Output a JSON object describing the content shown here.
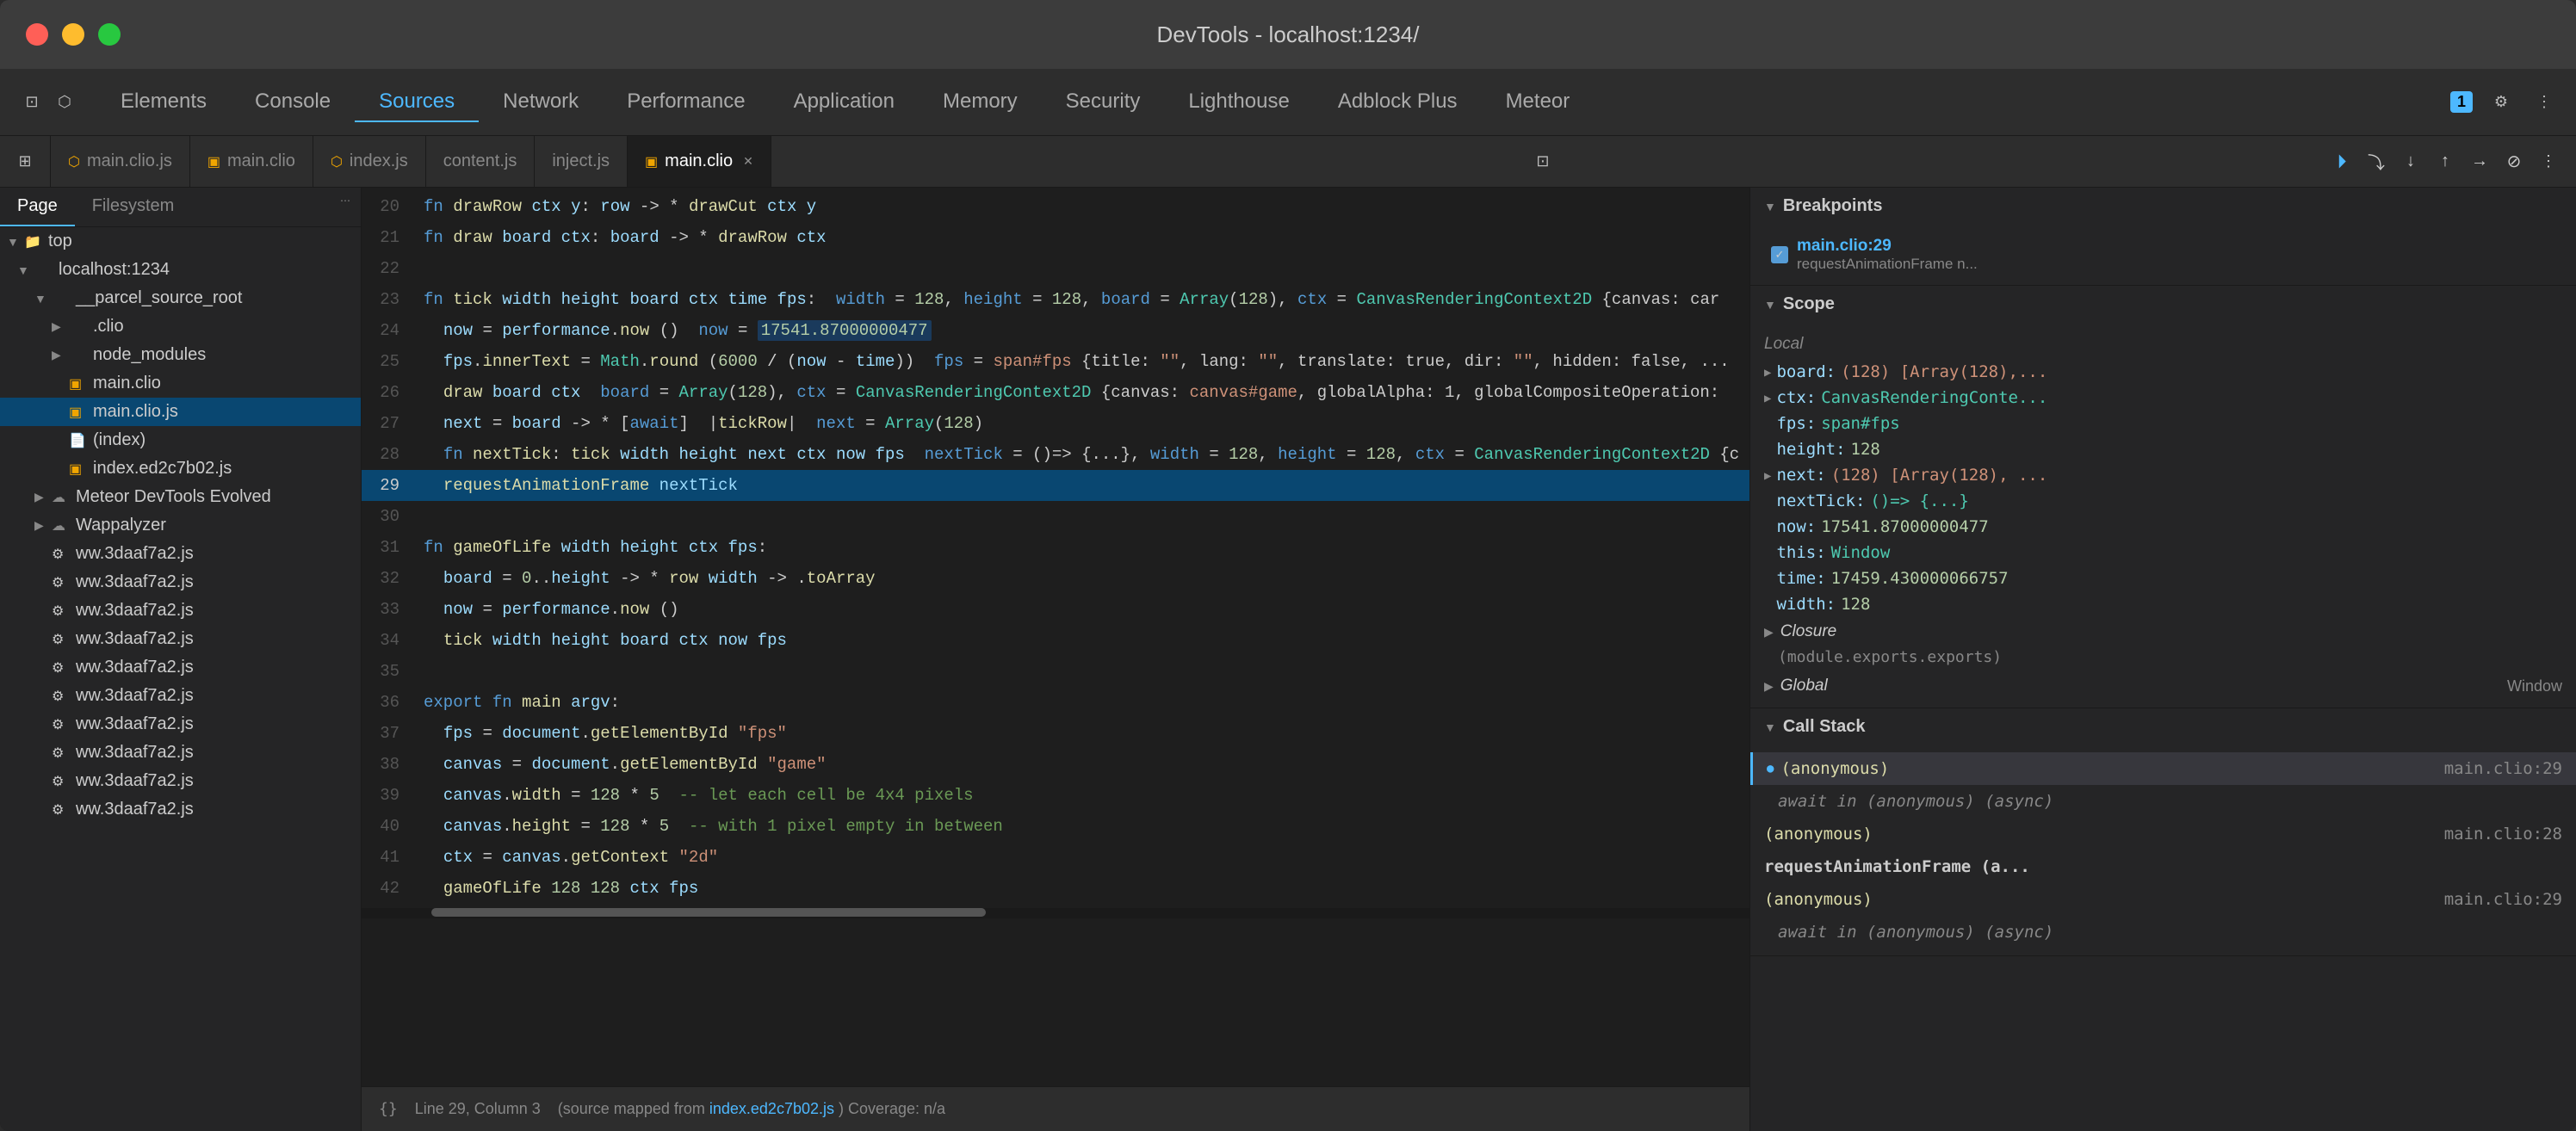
{
  "window": {
    "title": "DevTools - localhost:1234/"
  },
  "toolbar": {
    "nav_items": [
      {
        "label": "Elements",
        "active": false
      },
      {
        "label": "Console",
        "active": false
      },
      {
        "label": "Sources",
        "active": true
      },
      {
        "label": "Network",
        "active": false
      },
      {
        "label": "Performance",
        "active": false
      },
      {
        "label": "Application",
        "active": false
      },
      {
        "label": "Memory",
        "active": false
      },
      {
        "label": "Security",
        "active": false
      },
      {
        "label": "Lighthouse",
        "active": false
      },
      {
        "label": "Adblock Plus",
        "active": false
      },
      {
        "label": "Meteor",
        "active": false
      }
    ],
    "badge": "1"
  },
  "tabs": [
    {
      "label": "main.clio.js",
      "icon": "js",
      "active": false,
      "closeable": false
    },
    {
      "label": "main.clio",
      "icon": "clio",
      "active": false,
      "closeable": false
    },
    {
      "label": "index.js",
      "icon": "js",
      "active": false,
      "closeable": false
    },
    {
      "label": "content.js",
      "icon": "js",
      "active": false,
      "closeable": false
    },
    {
      "label": "inject.js",
      "icon": "js",
      "active": false,
      "closeable": false
    },
    {
      "label": "main.clio",
      "icon": "clio",
      "active": true,
      "closeable": true
    }
  ],
  "sidebar": {
    "tabs": [
      "Page",
      "Filesystem"
    ],
    "active_tab": "Page",
    "tree": [
      {
        "indent": 0,
        "type": "folder",
        "label": "top",
        "expanded": true
      },
      {
        "indent": 1,
        "type": "folder",
        "label": "localhost:1234",
        "expanded": true
      },
      {
        "indent": 2,
        "type": "folder",
        "label": "__parcel_source_root",
        "expanded": true
      },
      {
        "indent": 3,
        "type": "folder",
        "label": ".clio",
        "expanded": false
      },
      {
        "indent": 3,
        "type": "folder",
        "label": "node_modules",
        "expanded": false
      },
      {
        "indent": 3,
        "type": "file",
        "label": "main.clio",
        "selected": false
      },
      {
        "indent": 3,
        "type": "file-js",
        "label": "main.clio.js",
        "selected": false,
        "highlighted": true
      },
      {
        "indent": 3,
        "type": "file",
        "label": "(index)",
        "selected": false
      },
      {
        "indent": 3,
        "type": "file-js",
        "label": "index.ed2c7b02.js",
        "selected": false
      },
      {
        "indent": 2,
        "type": "folder-cloud",
        "label": "Meteor DevTools Evolved",
        "expanded": false
      },
      {
        "indent": 2,
        "type": "folder-cloud",
        "label": "Wappalyzer",
        "expanded": false
      },
      {
        "indent": 2,
        "type": "file-js",
        "label": "ww.3daaf7a2.js",
        "selected": false
      },
      {
        "indent": 2,
        "type": "file-js",
        "label": "ww.3daaf7a2.js",
        "selected": false
      },
      {
        "indent": 2,
        "type": "file-js",
        "label": "ww.3daaf7a2.js",
        "selected": false
      },
      {
        "indent": 2,
        "type": "file-js",
        "label": "ww.3daaf7a2.js",
        "selected": false
      },
      {
        "indent": 2,
        "type": "file-js",
        "label": "ww.3daaf7a2.js",
        "selected": false
      },
      {
        "indent": 2,
        "type": "file-js",
        "label": "ww.3daaf7a2.js",
        "selected": false
      },
      {
        "indent": 2,
        "type": "file-js",
        "label": "ww.3daaf7a2.js",
        "selected": false
      },
      {
        "indent": 2,
        "type": "file-js",
        "label": "ww.3daaf7a2.js",
        "selected": false
      },
      {
        "indent": 2,
        "type": "file-js",
        "label": "ww.3daaf7a2.js",
        "selected": false
      },
      {
        "indent": 2,
        "type": "file-js",
        "label": "ww.3daaf7a2.js",
        "selected": false
      }
    ]
  },
  "code": {
    "lines": [
      {
        "num": 20,
        "content": "fn drawRow ctx y: row -> * drawCut ctx y"
      },
      {
        "num": 21,
        "content": "fn draw board ctx: board -> * drawRow ctx"
      },
      {
        "num": 22,
        "content": ""
      },
      {
        "num": 23,
        "content": "fn tick width height board ctx time fps:  width = 128, height = 128, board = Array(128), ctx = CanvasRenderingContext2D {canvas: car"
      },
      {
        "num": 24,
        "content": "  now = performance.now ()  now = 17541.87000000477"
      },
      {
        "num": 25,
        "content": "  fps.innerText = Math.round (6000 / (now - time))  fps = span#fps {title: \"\", lang: \"\", translate: true, dir: \"\", hidden: false, ..."
      },
      {
        "num": 26,
        "content": "  draw board ctx  board = Array(128), ctx = CanvasRenderingContext2D {canvas: canvas#game, globalAlpha: 1, globalCompositeOperation:"
      },
      {
        "num": 27,
        "content": "  next = board -> * [await]  |tickRow|  next = Array(128)"
      },
      {
        "num": 28,
        "content": "  fn nextTick: tick width height next ctx now fps  nextTick = ()=> {...}, width = 128, height = 128, ctx = CanvasRenderingContext2D {c"
      },
      {
        "num": 29,
        "content": "  requestAnimationFrame nextTick",
        "current": true,
        "highlighted": true
      },
      {
        "num": 30,
        "content": ""
      },
      {
        "num": 31,
        "content": "fn gameOfLife width height ctx fps:"
      },
      {
        "num": 32,
        "content": "  board = 0..height -> * row width -> .toArray"
      },
      {
        "num": 33,
        "content": "  now = performance.now ()"
      },
      {
        "num": 34,
        "content": "  tick width height board ctx now fps"
      },
      {
        "num": 35,
        "content": ""
      },
      {
        "num": 36,
        "content": "export fn main argv:"
      },
      {
        "num": 37,
        "content": "  fps = document.getElementById \"fps\""
      },
      {
        "num": 38,
        "content": "  canvas = document.getElementById \"game\""
      },
      {
        "num": 39,
        "content": "  canvas.width = 128 * 5  -- let each cell be 4x4 pixels"
      },
      {
        "num": 40,
        "content": "  canvas.height = 128 * 5  -- with 1 pixel empty in between"
      },
      {
        "num": 41,
        "content": "  ctx = canvas.getContext \"2d\""
      },
      {
        "num": 42,
        "content": "  gameOfLife 128 128 ctx fps"
      }
    ]
  },
  "right_panel": {
    "breakpoints_header": "Breakpoints",
    "breakpoints": [
      {
        "file": "main.clio:29",
        "text": "requestAnimationFrame n..."
      }
    ],
    "scope_header": "Scope",
    "scope_local_header": "Local",
    "scope_items": [
      {
        "key": "board:",
        "val": "(128) [Array(128),...",
        "arrow": true
      },
      {
        "key": "ctx:",
        "val": "CanvasRenderin...",
        "arrow": false
      },
      {
        "key": "fps:",
        "val": "span#fps",
        "arrow": false
      },
      {
        "key": "height:",
        "val": "128",
        "arrow": false
      },
      {
        "key": "next:",
        "val": "(128) [Array(128), ...",
        "arrow": true
      },
      {
        "key": "nextTick:",
        "val": "()=> {...}",
        "arrow": false
      },
      {
        "key": "now:",
        "val": "17541.87000000477",
        "arrow": false
      },
      {
        "key": "this:",
        "val": "Window",
        "arrow": false
      },
      {
        "key": "time:",
        "val": "17459.430000066757",
        "arrow": false
      },
      {
        "key": "width:",
        "val": "128",
        "arrow": false
      }
    ],
    "scope_closure_header": "Closure",
    "scope_closure_text": "(module.exports.exports)",
    "scope_global_header": "Global",
    "scope_global_val": "Window",
    "callstack_header": "Call Stack",
    "callstack_items": [
      {
        "name": "(anonymous)",
        "file": "main.clio:29",
        "current": true,
        "dot": true
      },
      {
        "name": "await in (anonymous) (async)",
        "file": "",
        "async": true
      },
      {
        "name": "(anonymous)",
        "file": "main.clio:28",
        "current": false
      },
      {
        "name": "requestAnimationFrame (a...",
        "file": "",
        "bold": true
      },
      {
        "name": "(anonymous)",
        "file": "main.clio:29",
        "current": false
      },
      {
        "name": "await in (anonymous) (async)",
        "file": "",
        "async": true
      }
    ]
  },
  "statusbar": {
    "position": "Line 29, Column 3",
    "source_mapped": "(source mapped from",
    "source_file": "index.ed2c7b02.js",
    "coverage": ") Coverage: n/a",
    "format_icon": "{}"
  }
}
